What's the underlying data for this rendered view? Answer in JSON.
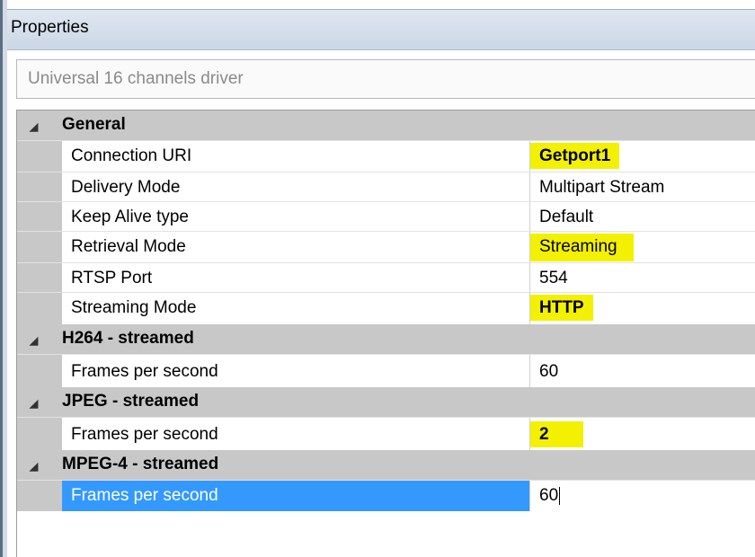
{
  "panel": {
    "title": "Properties"
  },
  "object_selector": {
    "value": "Universal 16 channels driver"
  },
  "categories": [
    {
      "title": "General",
      "properties": [
        {
          "name": "Connection URI",
          "value": "Getport1"
        },
        {
          "name": "Delivery Mode",
          "value": "Multipart Stream"
        },
        {
          "name": "Keep Alive type",
          "value": "Default"
        },
        {
          "name": "Retrieval Mode",
          "value": "Streaming"
        },
        {
          "name": "RTSP Port",
          "value": "554"
        },
        {
          "name": "Streaming Mode",
          "value": "HTTP"
        }
      ]
    },
    {
      "title": "H264 - streamed",
      "properties": [
        {
          "name": "Frames per second",
          "value": "60"
        }
      ]
    },
    {
      "title": "JPEG - streamed",
      "properties": [
        {
          "name": "Frames per second",
          "value": "2"
        }
      ]
    },
    {
      "title": "MPEG-4 - streamed",
      "properties": [
        {
          "name": "Frames per second",
          "value": "60"
        }
      ]
    }
  ],
  "colors": {
    "highlight": "#f3f000",
    "selection": "#3399ff",
    "category_bg": "#c8c8c8"
  }
}
